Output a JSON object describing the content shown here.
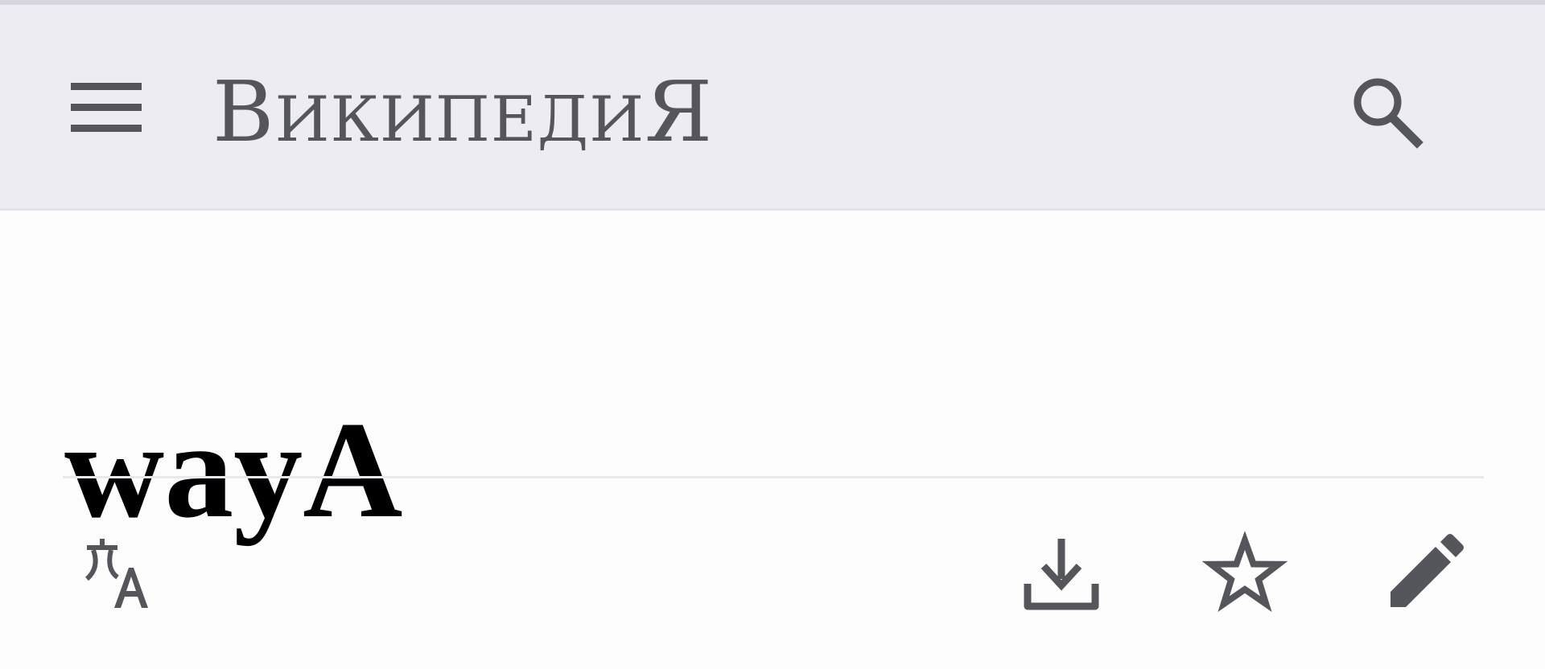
{
  "header": {
    "logo_cap_1": "В",
    "logo_rest": "ИКИПЕДИ",
    "logo_cap_2": "Я",
    "menu_icon": "hamburger-menu-icon",
    "search_icon": "search-icon"
  },
  "article": {
    "title": "wayA"
  },
  "actions": {
    "language_icon": "translate-icon",
    "download_icon": "download-icon",
    "watch_icon": "star-icon",
    "edit_icon": "pencil-icon"
  },
  "colors": {
    "header_bg": "#ececf2",
    "icon": "#55565b",
    "page_bg": "#fdfdfe"
  }
}
